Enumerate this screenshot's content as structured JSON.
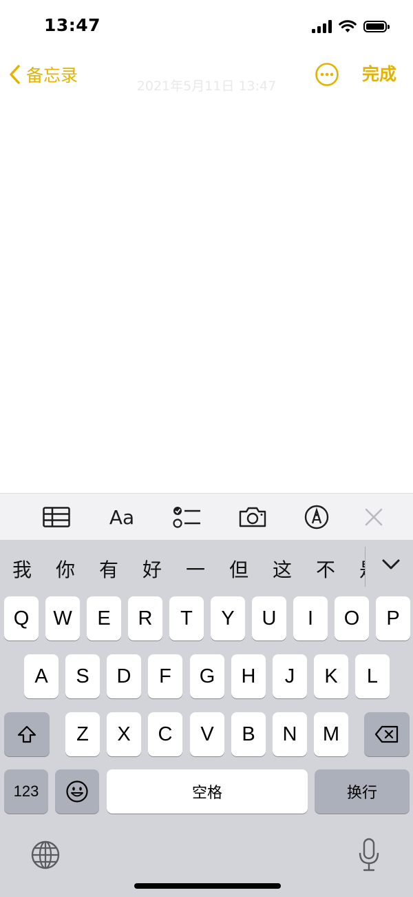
{
  "status_bar": {
    "time": "13:47"
  },
  "nav": {
    "back_label": "备忘录",
    "done_label": "完成",
    "accent_color": "#E2B300"
  },
  "note": {
    "date_text": "2021年5月11日 13:47"
  },
  "format_toolbar": {
    "items": [
      "table-icon",
      "text-format",
      "checklist-icon",
      "camera-icon",
      "markup-icon",
      "close-icon"
    ],
    "text_format_label": "Aa"
  },
  "keyboard": {
    "candidates": [
      "我",
      "你",
      "有",
      "好",
      "一",
      "但",
      "这",
      "不",
      "是"
    ],
    "row1": [
      "Q",
      "W",
      "E",
      "R",
      "T",
      "Y",
      "U",
      "I",
      "O",
      "P"
    ],
    "row2": [
      "A",
      "S",
      "D",
      "F",
      "G",
      "H",
      "J",
      "K",
      "L"
    ],
    "row3": [
      "Z",
      "X",
      "C",
      "V",
      "B",
      "N",
      "M"
    ],
    "numbers_label": "123",
    "space_label": "空格",
    "return_label": "换行"
  }
}
